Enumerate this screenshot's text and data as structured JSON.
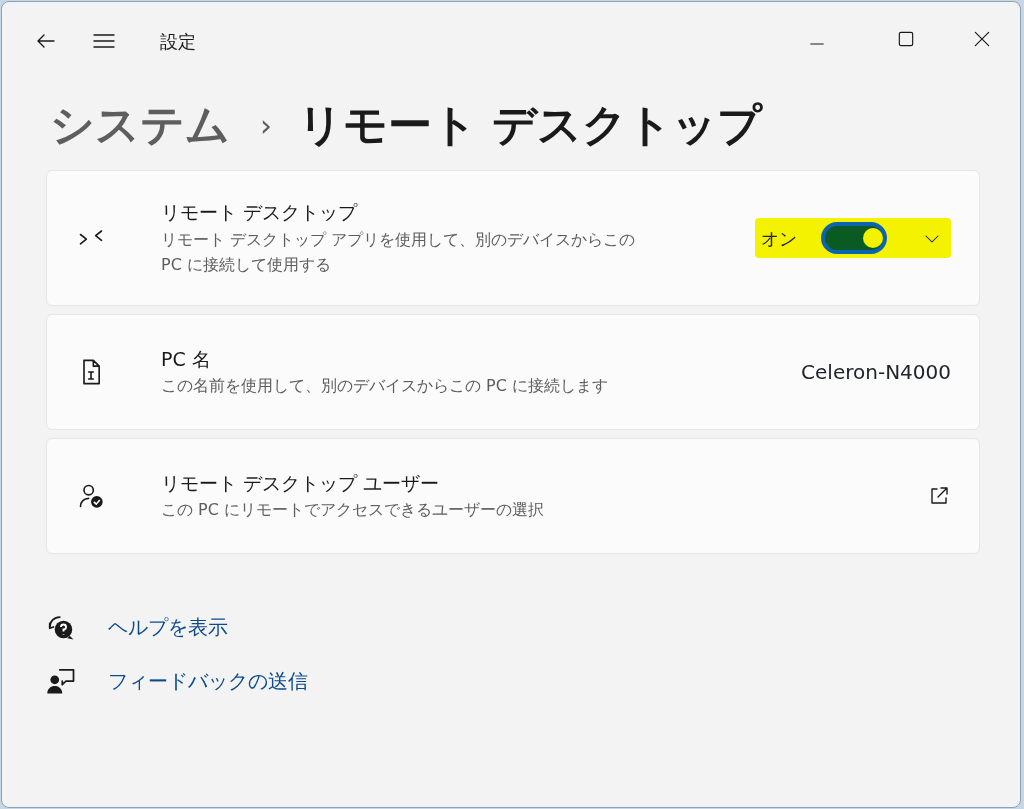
{
  "window": {
    "title": "設定"
  },
  "breadcrumb": {
    "parent": "システム",
    "separator": "›",
    "current": "リモート デスクトップ"
  },
  "cards": [
    {
      "kind": "toggle",
      "title": "リモート デスクトップ",
      "description": "リモート デスクトップ アプリを使用して、別のデバイスからこの\nPC に接続して使用する",
      "state_label": "オン",
      "on": true,
      "expanded": false,
      "highlighted": true
    },
    {
      "kind": "value",
      "title": "PC 名",
      "description": "この名前を使用して、別のデバイスからこの PC に接続します",
      "value": "Celeron-N4000"
    },
    {
      "kind": "external",
      "title": "リモート デスクトップ ユーザー",
      "description": "この PC にリモートでアクセスできるユーザーの選択"
    }
  ],
  "links": [
    {
      "kind": "help",
      "label": "ヘルプを表示"
    },
    {
      "kind": "feedback",
      "label": "フィードバックの送信"
    }
  ]
}
